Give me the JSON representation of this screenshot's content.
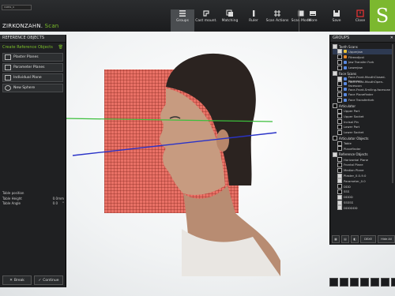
{
  "app": {
    "version_label": "V4851_0",
    "brand_main": "ZIRKONZAHN.",
    "brand_sub": "Scan",
    "logo_letter": "S"
  },
  "toolbar_main": [
    {
      "label": "Groups",
      "icon": "groups-icon",
      "active": true
    },
    {
      "label": "Cast mount.",
      "icon": "cast-mount-icon"
    },
    {
      "label": "Matching",
      "icon": "matching-icon"
    },
    {
      "label": "Ruler",
      "icon": "ruler-icon"
    },
    {
      "label": "Scan Actions",
      "icon": "scan-actions-icon"
    },
    {
      "label": "Scan Mode",
      "icon": "scan-mode-icon"
    }
  ],
  "toolbar_right": [
    {
      "label": "More",
      "icon": "more-icon"
    },
    {
      "label": "Save",
      "icon": "save-icon"
    },
    {
      "label": "Close",
      "icon": "close-icon"
    }
  ],
  "left_panel": {
    "title": "REFERENCE OBJECTS",
    "create_label": "Create Reference Objects",
    "buttons": [
      "Plaster Planes",
      "Parameter Planes",
      "Individual Plane",
      "New Sphere"
    ],
    "table_position": {
      "title": "Table position",
      "rows": [
        {
          "label": "Table Height",
          "value": "0.0",
          "unit": "mm"
        },
        {
          "label": "Table Angle",
          "value": "0.0",
          "unit": "°"
        }
      ]
    },
    "back_label": "Break",
    "continue_label": "Continue"
  },
  "right_panel": {
    "title": "GROUPS",
    "groups": [
      {
        "name": "Teeth Scans",
        "checked": true,
        "items": [
          {
            "label": "Upperjaw",
            "color": "#e8c23a",
            "checked": true,
            "highlight": true
          },
          {
            "label": "Fitreadjust",
            "color": "#e88a2a",
            "checked": false
          },
          {
            "label": "Jaw Transfer Fork",
            "color": "#5a8ae0",
            "checked": false
          },
          {
            "label": "Lowerjaw",
            "color": "#5a8ae0",
            "checked": false
          }
        ]
      },
      {
        "name": "Face Scans",
        "checked": true,
        "items": [
          {
            "label": "Face-Front-MouthClosed-facescan",
            "color": "#5a8ae0",
            "checked": true
          },
          {
            "label": "Face-Front-MouthOpen-facescan",
            "color": "#5a8ae0",
            "checked": false
          },
          {
            "label": "Face-Front-Smiling-facescan",
            "color": "#5a8ae0",
            "checked": false
          },
          {
            "label": "Face Planefinder",
            "color": "#5a8ae0",
            "checked": false
          },
          {
            "label": "Face Transferfork",
            "color": "#5a8ae0",
            "checked": false
          }
        ]
      },
      {
        "name": "Articulator",
        "checked": false,
        "items": [
          {
            "label": "Upper Part",
            "checked": false
          },
          {
            "label": "Upper Socket",
            "checked": false
          },
          {
            "label": "Incisal Pin",
            "checked": false
          },
          {
            "label": "Lower Part",
            "checked": false
          },
          {
            "label": "Lower Socket",
            "checked": false
          }
        ]
      },
      {
        "name": "Articulator Objects",
        "checked": false,
        "items": [
          {
            "label": "Table",
            "checked": false
          },
          {
            "label": "Planefinder",
            "checked": false
          }
        ]
      },
      {
        "name": "Reference Objects",
        "checked": true,
        "items": [
          {
            "label": "Horizontal Plane",
            "checked": false
          },
          {
            "label": "Frontal Plane",
            "checked": false
          },
          {
            "label": "Median Plane",
            "checked": false
          },
          {
            "label": "Plaster_0.0-9.0",
            "checked": true
          },
          {
            "label": "Parameter_0.0",
            "checked": true
          },
          {
            "label": "DDD",
            "checked": false
          },
          {
            "label": "SSS",
            "checked": false
          },
          {
            "label": "DDDD",
            "checked": true
          },
          {
            "label": "SSSSS",
            "checked": true
          },
          {
            "label": "DDDDDD",
            "checked": true
          }
        ]
      }
    ],
    "tools": [
      "DEXE",
      "Hide All"
    ]
  }
}
